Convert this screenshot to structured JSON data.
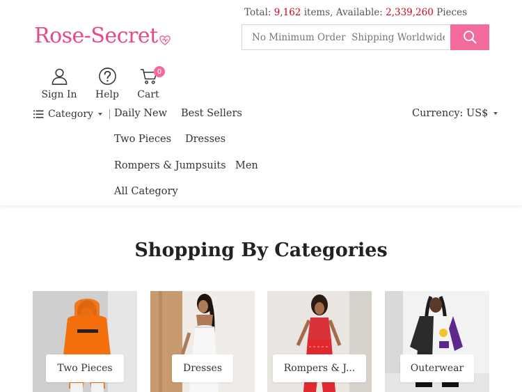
{
  "header": {
    "stats": {
      "total_label": "Total:",
      "total_value": "9,162",
      "items_label": "items, Available:",
      "available_value": "2,339,260",
      "pieces_label": "Pieces"
    },
    "logo_text": "Rose-Secret",
    "search": {
      "placeholder": "No Minimum Order  Shipping Worldwide"
    },
    "user_nav": [
      {
        "label": "Sign In",
        "icon": "user-icon"
      },
      {
        "label": "Help",
        "icon": "help-icon"
      },
      {
        "label": "Cart",
        "icon": "cart-icon",
        "badge": "0"
      }
    ],
    "category_toggle": "Category",
    "menu": [
      "Daily New",
      "Best Sellers",
      "Two Pieces",
      "Dresses",
      "Rompers & Jumpsuits",
      "Men",
      "All Category"
    ],
    "currency": "Currency: US$"
  },
  "section": {
    "title": "Shopping By Categories",
    "categories": [
      {
        "label": "Two Pieces",
        "image": "orange-hoodie-outfit-photo"
      },
      {
        "label": "Dresses",
        "image": "white-dress-photo"
      },
      {
        "label": "Rompers & J...",
        "image": "red-jumpsuit-photo"
      },
      {
        "label": "Outerwear",
        "image": "varsity-jacket-photo"
      }
    ]
  },
  "colors": {
    "brand_pink": "#f26b9c",
    "logo_pink": "#e5498a",
    "stat_red": "#d0021b"
  }
}
